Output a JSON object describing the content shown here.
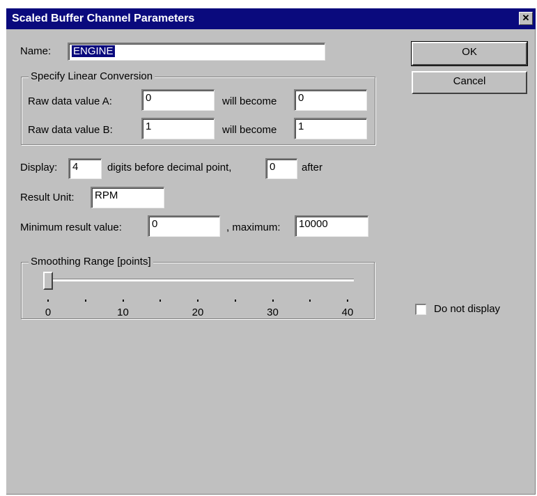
{
  "window": {
    "title": "Scaled Buffer Channel Parameters",
    "close_glyph": "✕"
  },
  "name": {
    "label": "Name:",
    "value": "ENGINE"
  },
  "buttons": {
    "ok": "OK",
    "cancel": "Cancel"
  },
  "linear_conversion": {
    "legend": "Specify Linear Conversion",
    "row_a": {
      "label": "Raw data value A:",
      "raw": "0",
      "will_become_label": "will become",
      "result": "0"
    },
    "row_b": {
      "label": "Raw data value B:",
      "raw": "1",
      "will_become_label": "will become",
      "result": "1"
    }
  },
  "display": {
    "label": "Display:",
    "digits_before": "4",
    "digits_before_text": "digits before decimal point,",
    "digits_after": "0",
    "after_text": "after"
  },
  "result_unit": {
    "label": "Result Unit:",
    "value": "RPM"
  },
  "range": {
    "min_label": "Minimum result value:",
    "min_value": "0",
    "max_label": ", maximum:",
    "max_value": "10000"
  },
  "smoothing": {
    "legend": "Smoothing Range [points]",
    "value": 0,
    "min": 0,
    "max": 40,
    "tick_labels": [
      "0",
      "10",
      "20",
      "30",
      "40"
    ]
  },
  "do_not_display": {
    "label": "Do not display",
    "checked": false
  }
}
